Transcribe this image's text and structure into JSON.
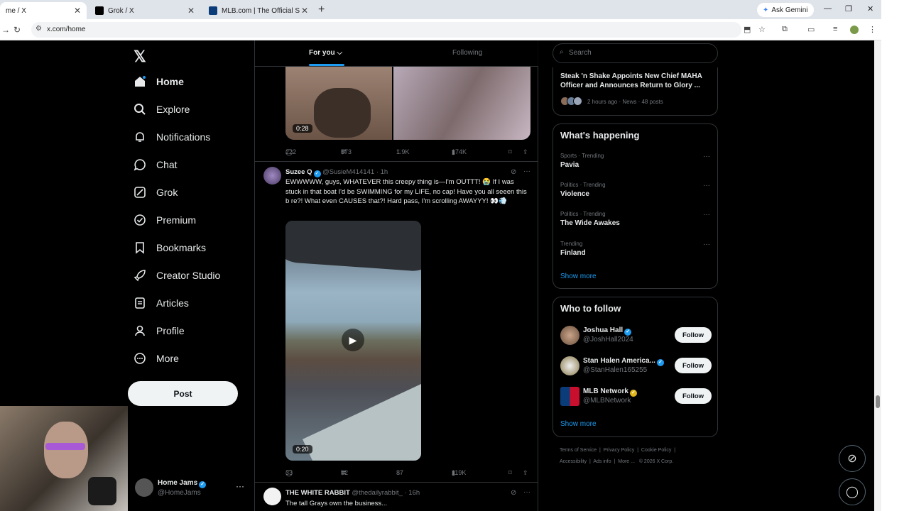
{
  "browser": {
    "tabs": [
      {
        "title": "me / X",
        "icon": "x-icon"
      },
      {
        "title": "Grok / X",
        "icon": "x-icon"
      },
      {
        "title": "MLB.com | The Official Site of M",
        "icon": "mlb-icon"
      }
    ],
    "new_tab": "+",
    "ask_gemini": "Ask Gemini",
    "url": "x.com/home"
  },
  "nav": {
    "items": [
      {
        "label": "Home",
        "icon": "home-icon"
      },
      {
        "label": "Explore",
        "icon": "search-icon"
      },
      {
        "label": "Notifications",
        "icon": "bell-icon"
      },
      {
        "label": "Chat",
        "icon": "chat-icon"
      },
      {
        "label": "Grok",
        "icon": "grok-icon"
      },
      {
        "label": "Premium",
        "icon": "premium-icon"
      },
      {
        "label": "Bookmarks",
        "icon": "bookmark-icon"
      },
      {
        "label": "Creator Studio",
        "icon": "rocket-icon"
      },
      {
        "label": "Articles",
        "icon": "articles-icon"
      },
      {
        "label": "Profile",
        "icon": "person-icon"
      },
      {
        "label": "More",
        "icon": "more-circle-icon"
      }
    ],
    "post_label": "Post",
    "account": {
      "name": "Home Jams",
      "handle": "@HomeJams"
    }
  },
  "feed": {
    "tabs": {
      "for_you": "For you",
      "following": "Following"
    },
    "tweet1": {
      "duration": "0:28",
      "replies": "222",
      "reposts": "573",
      "likes": "1.9K",
      "views": "174K"
    },
    "tweet2": {
      "name": "Suzee Q",
      "handle": "@SusieM414141",
      "time": "· 1h",
      "text": "EWWWWW, guys, WHATEVER this creepy thing is—I'm OUTTT! 😭 If I was stuck in that boat I'd be SWIMMING for my LIFE, no cap! Have you all seeen this b   re?! What even CAUSES that?! Hard pass, I'm scrolling AWAYYY! 👀💨",
      "duration": "0:20",
      "replies": "33",
      "reposts": "52",
      "likes": "87",
      "views": "119K"
    },
    "tweet3": {
      "name": "THE WHITE RABBIT",
      "handle": "@thedailyrabbit_",
      "time": "· 16h",
      "text": "The tall Grays own the business..."
    }
  },
  "sidebar": {
    "search_placeholder": "Search",
    "news": {
      "title": "Steak 'n Shake Appoints New Chief MAHA Officer and Announces Return to Glory ...",
      "meta": "2 hours ago · News · 48 posts"
    },
    "happening": {
      "title": "What's happening",
      "trends": [
        {
          "context": "Sports · Trending",
          "name": "Pavia"
        },
        {
          "context": "Politics · Trending",
          "name": "Violence"
        },
        {
          "context": "Politics · Trending",
          "name": "The Wide Awakes"
        },
        {
          "context": "Trending",
          "name": "Finland"
        }
      ],
      "show_more": "Show more"
    },
    "who_to_follow": {
      "title": "Who to follow",
      "accounts": [
        {
          "name": "Joshua Hall",
          "handle": "@JoshHall2024",
          "badge": "blue"
        },
        {
          "name": "Stan Halen America...",
          "handle": "@StanHalen165255",
          "badge": "blue"
        },
        {
          "name": "MLB Network",
          "handle": "@MLBNetwork",
          "badge": "gold"
        }
      ],
      "follow_label": "Follow",
      "show_more": "Show more"
    },
    "footer": {
      "links": [
        "Terms of Service",
        "Privacy Policy",
        "Cookie Policy",
        "Accessibility",
        "Ads info",
        "More ...",
        "© 2026 X Corp."
      ]
    }
  },
  "colors": {
    "accent": "#1d9bf0",
    "gold": "#e2b719",
    "bg": "#000000"
  }
}
